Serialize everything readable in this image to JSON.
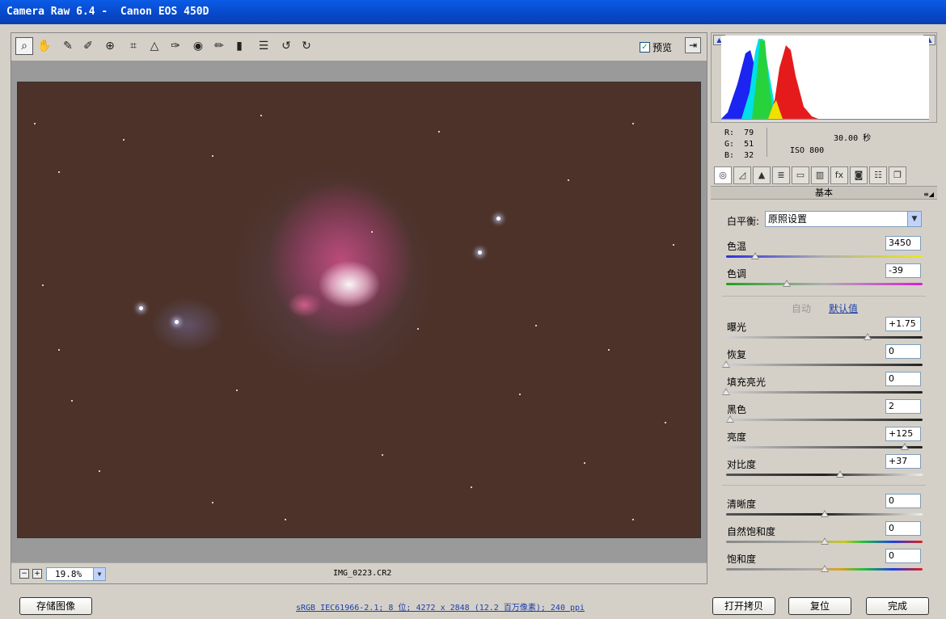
{
  "window": {
    "title": "Camera Raw 6.4 -  Canon EOS 450D"
  },
  "toolbar": {
    "tools": [
      "zoom-icon",
      "hand-icon",
      "white-balance-icon",
      "color-sampler-icon",
      "target-adjust-icon",
      "crop-icon",
      "straighten-icon",
      "spot-removal-icon",
      "red-eye-icon",
      "adjustment-brush-icon",
      "graduated-filter-icon",
      "preferences-icon",
      "rotate-left-icon",
      "rotate-right-icon"
    ],
    "preview_label": "预览",
    "preview_checked": true
  },
  "status": {
    "zoom_value": "19.8%",
    "filename": "IMG_0223.CR2"
  },
  "info": {
    "r_line": "R:  79",
    "g_line": "G:  51",
    "b_line": "B:  32",
    "shutter": "30.00 秒",
    "iso": "ISO 800"
  },
  "panel": {
    "title": "基本",
    "white_balance_label": "白平衡:",
    "white_balance_value": "原照设置",
    "auto_label": "自动",
    "default_label": "默认值",
    "sliders": [
      {
        "label": "色温",
        "value": "3450",
        "fraction": 0.15,
        "track": "temp"
      },
      {
        "label": "色调",
        "value": "-39",
        "fraction": 0.31,
        "track": "tint"
      },
      {
        "label": "曝光",
        "value": "+1.75",
        "fraction": 0.72,
        "track": "gray"
      },
      {
        "label": "恢复",
        "value": "0",
        "fraction": 0.0,
        "track": "gray"
      },
      {
        "label": "填充亮光",
        "value": "0",
        "fraction": 0.0,
        "track": "gray"
      },
      {
        "label": "黑色",
        "value": "2",
        "fraction": 0.02,
        "track": "gray"
      },
      {
        "label": "亮度",
        "value": "+125",
        "fraction": 0.91,
        "track": "gray"
      },
      {
        "label": "对比度",
        "value": "+37",
        "fraction": 0.58,
        "track": "dark"
      },
      {
        "label": "清晰度",
        "value": "0",
        "fraction": 0.5,
        "track": "dark"
      },
      {
        "label": "自然饱和度",
        "value": "0",
        "fraction": 0.5,
        "track": "vibrance"
      },
      {
        "label": "饱和度",
        "value": "0",
        "fraction": 0.5,
        "track": "saturation"
      }
    ]
  },
  "footer": {
    "save_label": "存储图像",
    "workflow_text": "sRGB IEC61966-2.1; 8 位; 4272 x 2848 (12.2 百万像素); 240 ppi",
    "open_copy_label": "打开拷贝",
    "reset_label": "复位",
    "done_label": "完成"
  }
}
